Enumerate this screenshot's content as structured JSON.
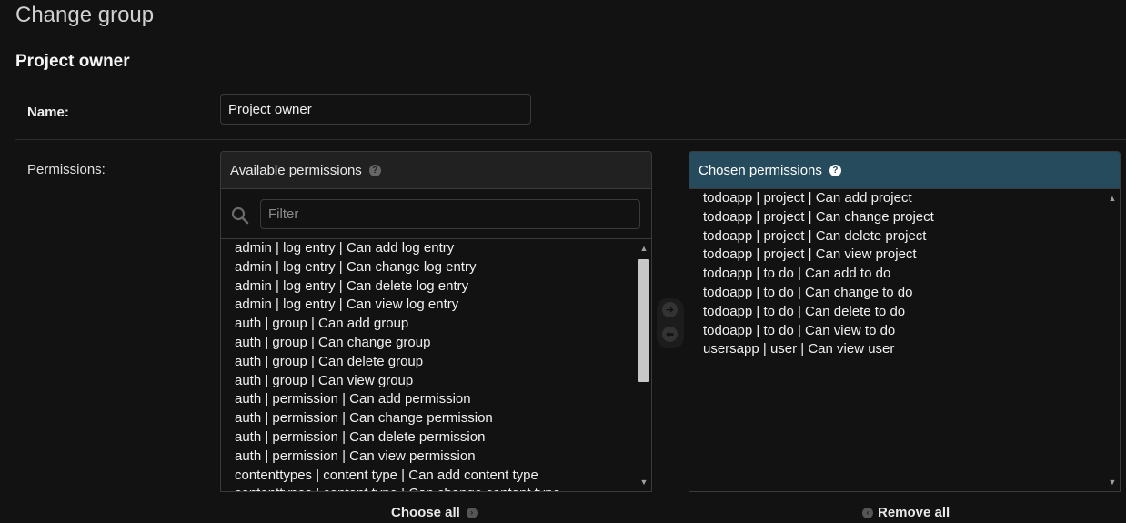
{
  "page": {
    "title": "Change group",
    "fieldset_title": "Project owner"
  },
  "name_field": {
    "label": "Name:",
    "value": "Project owner"
  },
  "permissions": {
    "label": "Permissions:",
    "available": {
      "header": "Available permissions",
      "filter_placeholder": "Filter",
      "items": [
        "admin | log entry | Can add log entry",
        "admin | log entry | Can change log entry",
        "admin | log entry | Can delete log entry",
        "admin | log entry | Can view log entry",
        "auth | group | Can add group",
        "auth | group | Can change group",
        "auth | group | Can delete group",
        "auth | group | Can view group",
        "auth | permission | Can add permission",
        "auth | permission | Can change permission",
        "auth | permission | Can delete permission",
        "auth | permission | Can view permission",
        "contenttypes | content type | Can add content type",
        "contenttypes | content type | Can change content type"
      ],
      "choose_all_label": "Choose all"
    },
    "chosen": {
      "header": "Chosen permissions",
      "items": [
        "todoapp | project | Can add project",
        "todoapp | project | Can change project",
        "todoapp | project | Can delete project",
        "todoapp | project | Can view project",
        "todoapp | to do | Can add to do",
        "todoapp | to do | Can change to do",
        "todoapp | to do | Can delete to do",
        "todoapp | to do | Can view to do",
        "usersapp | user | Can view user"
      ],
      "remove_all_label": "Remove all"
    }
  },
  "icons": {
    "help": "question-circle-icon",
    "search": "search-icon",
    "move_right": "arrow-right-circle-icon",
    "move_left": "arrow-left-circle-icon"
  },
  "colors": {
    "background": "#121212",
    "chosen_header": "#264b5d",
    "available_header": "#212121"
  }
}
